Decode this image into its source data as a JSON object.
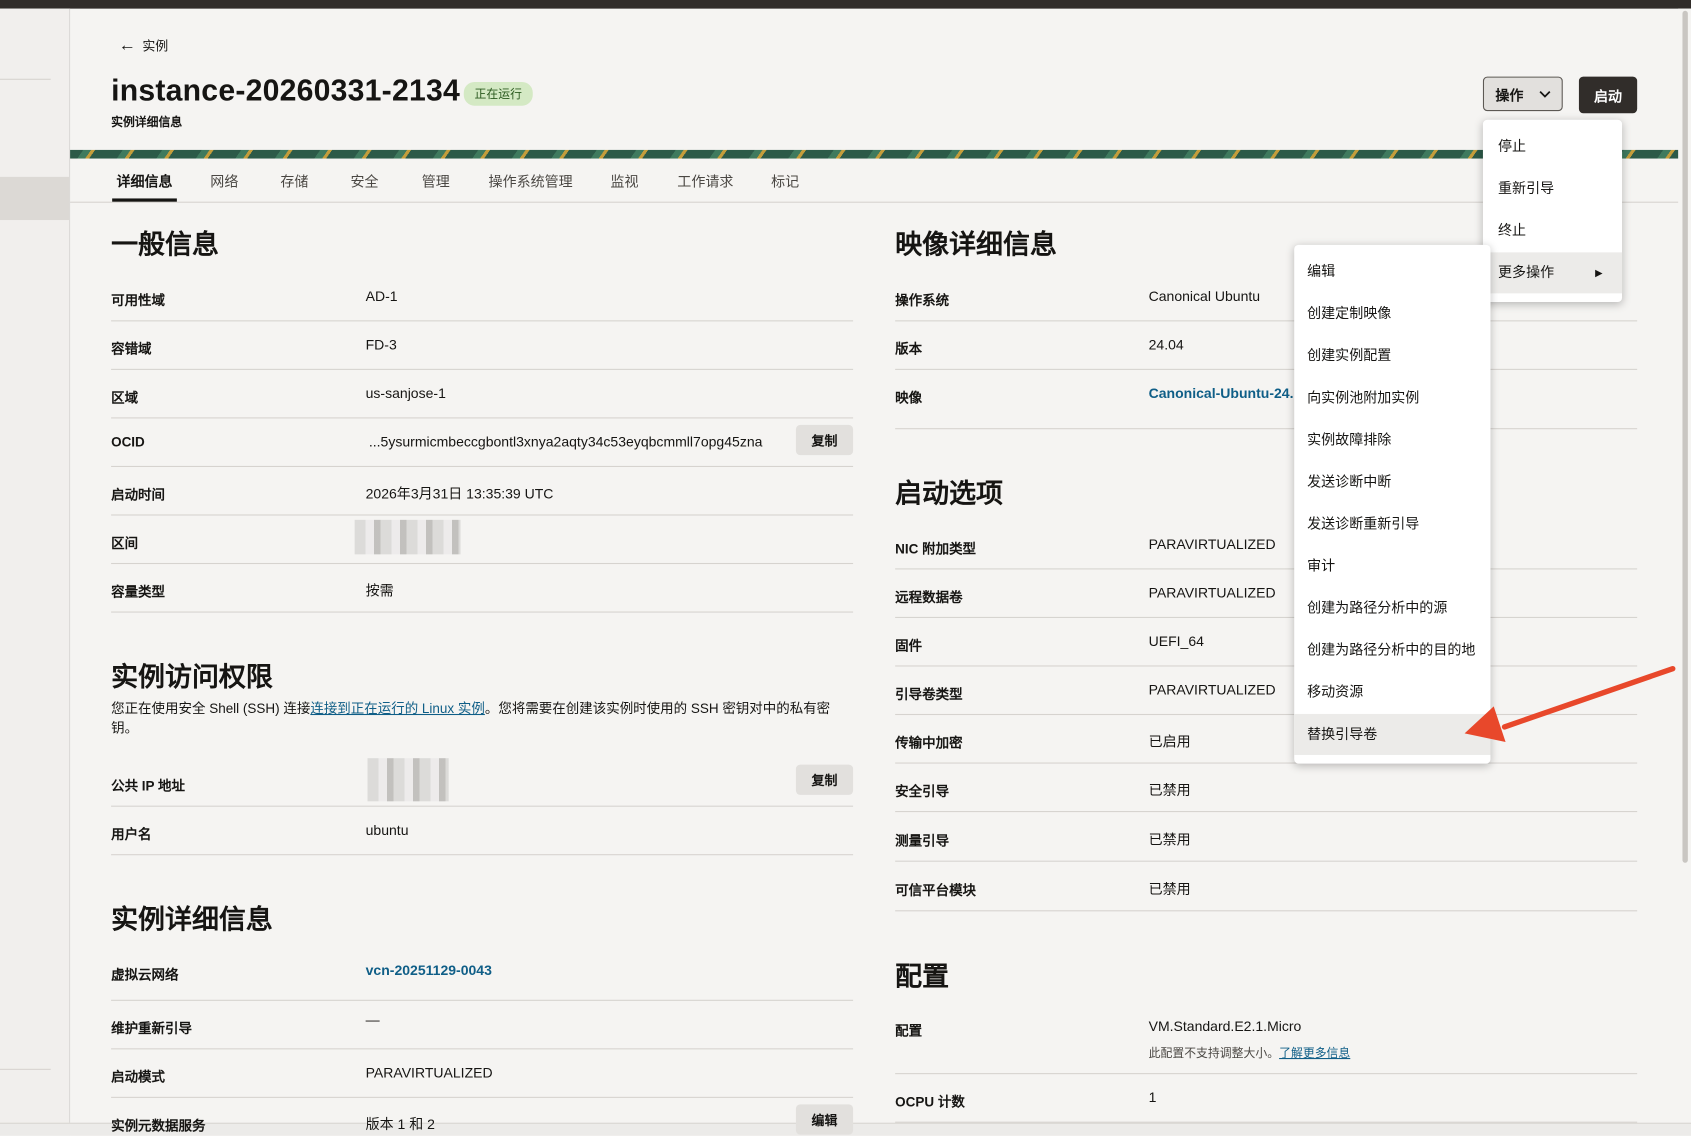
{
  "header": {
    "back_label": "实例",
    "title": "instance-20260331-2134",
    "status_badge": "正在运行",
    "subtitle": "实例详细信息",
    "actions_button": "操作",
    "start_button": "启动"
  },
  "tabs": [
    "详细信息",
    "网络",
    "存储",
    "安全",
    "管理",
    "操作系统管理",
    "监视",
    "工作请求",
    "标记"
  ],
  "general": {
    "title": "一般信息",
    "rows": [
      {
        "label": "可用性域",
        "value": "AD-1"
      },
      {
        "label": "容错域",
        "value": "FD-3"
      },
      {
        "label": "区域",
        "value": "us-sanjose-1"
      },
      {
        "label": "OCID",
        "value": "...5ysurmicmbeccgbontl3xnya2aqty34c53eyqbcmmll7opg45zna"
      },
      {
        "label": "启动时间",
        "value": "2026年3月31日 13:35:39 UTC"
      },
      {
        "label": "区间",
        "value": ""
      },
      {
        "label": "容量类型",
        "value": "按需"
      }
    ],
    "copy_label": "复制"
  },
  "access": {
    "title": "实例访问权限",
    "text_before": "您正在使用安全 Shell (SSH) 连接",
    "link_text": "连接到正在运行的 Linux 实例",
    "text_after": "。您将需要在创建该实例时使用的 SSH 密钥对中的私有密钥。",
    "rows": [
      {
        "label": "公共 IP 地址",
        "value": ""
      },
      {
        "label": "用户名",
        "value": "ubuntu"
      }
    ],
    "copy_label": "复制"
  },
  "instance_details": {
    "title": "实例详细信息",
    "rows": [
      {
        "label": "虚拟云网络",
        "value": "vcn-20251129-0043"
      },
      {
        "label": "维护重新引导",
        "value": "—"
      },
      {
        "label": "启动模式",
        "value": "PARAVIRTUALIZED"
      },
      {
        "label": "实例元数据服务",
        "value": "版本 1 和 2"
      }
    ],
    "edit_label": "编辑"
  },
  "image": {
    "title": "映像详细信息",
    "rows": [
      {
        "label": "操作系统",
        "value": "Canonical Ubuntu"
      },
      {
        "label": "版本",
        "value": "24.04"
      },
      {
        "label": "映像",
        "value": "Canonical-Ubuntu-24."
      }
    ]
  },
  "launch": {
    "title": "启动选项",
    "rows": [
      {
        "label": "NIC 附加类型",
        "value": "PARAVIRTUALIZED"
      },
      {
        "label": "远程数据卷",
        "value": "PARAVIRTUALIZED"
      },
      {
        "label": "固件",
        "value": "UEFI_64"
      },
      {
        "label": "引导卷类型",
        "value": "PARAVIRTUALIZED"
      },
      {
        "label": "传输中加密",
        "value": "已启用"
      },
      {
        "label": "安全引导",
        "value": "已禁用"
      },
      {
        "label": "测量引导",
        "value": "已禁用"
      },
      {
        "label": "可信平台模块",
        "value": "已禁用"
      }
    ]
  },
  "config": {
    "title": "配置",
    "rows": [
      {
        "label": "配置",
        "value": "VM.Standard.E2.1.Micro"
      },
      {
        "label": "OCPU 计数",
        "value": "1"
      }
    ],
    "note_text": "此配置不支持调整大小。",
    "note_link": "了解更多信息"
  },
  "actions_menu": {
    "items": [
      "停止",
      "重新引导",
      "终止",
      "更多操作"
    ],
    "highlighted": "更多操作"
  },
  "more_actions_menu": {
    "items": [
      "编辑",
      "创建定制映像",
      "创建实例配置",
      "向实例池附加实例",
      "实例故障排除",
      "发送诊断中断",
      "发送诊断重新引导",
      "审计",
      "创建为路径分析中的源",
      "创建为路径分析中的目的地",
      "移动资源",
      "替换引导卷"
    ],
    "highlighted": "替换引导卷"
  },
  "colors": {
    "accent_dark": "#312d2a",
    "link": "#0f5e87",
    "badge_bg": "#d4e9c4",
    "annotation_arrow": "#e8482b"
  }
}
